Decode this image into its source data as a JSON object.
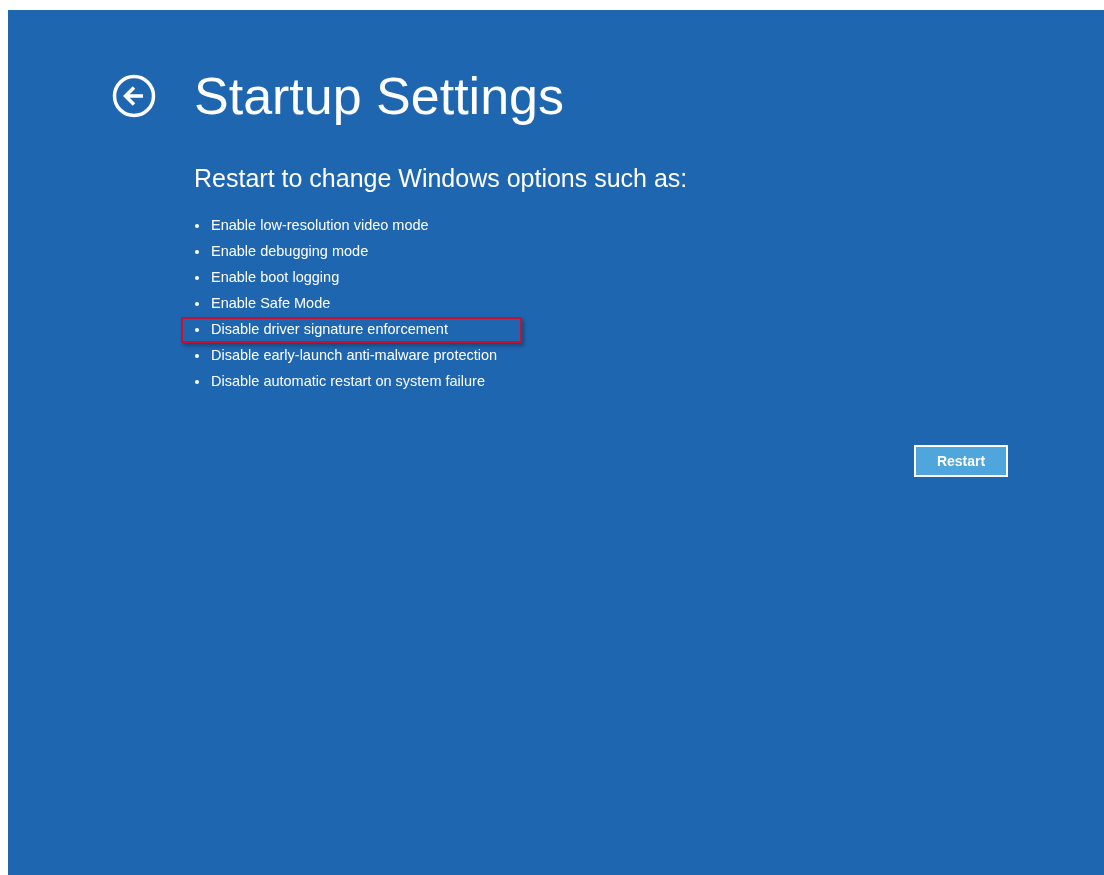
{
  "title": "Startup Settings",
  "subtitle": "Restart to change Windows options such as:",
  "options": [
    {
      "label": "Enable low-resolution video mode",
      "highlighted": false
    },
    {
      "label": "Enable debugging mode",
      "highlighted": false
    },
    {
      "label": "Enable boot logging",
      "highlighted": false
    },
    {
      "label": "Enable Safe Mode",
      "highlighted": false
    },
    {
      "label": "Disable driver signature enforcement",
      "highlighted": true
    },
    {
      "label": "Disable early-launch anti-malware protection",
      "highlighted": false
    },
    {
      "label": "Disable automatic restart on system failure",
      "highlighted": false
    }
  ],
  "button": "Restart"
}
